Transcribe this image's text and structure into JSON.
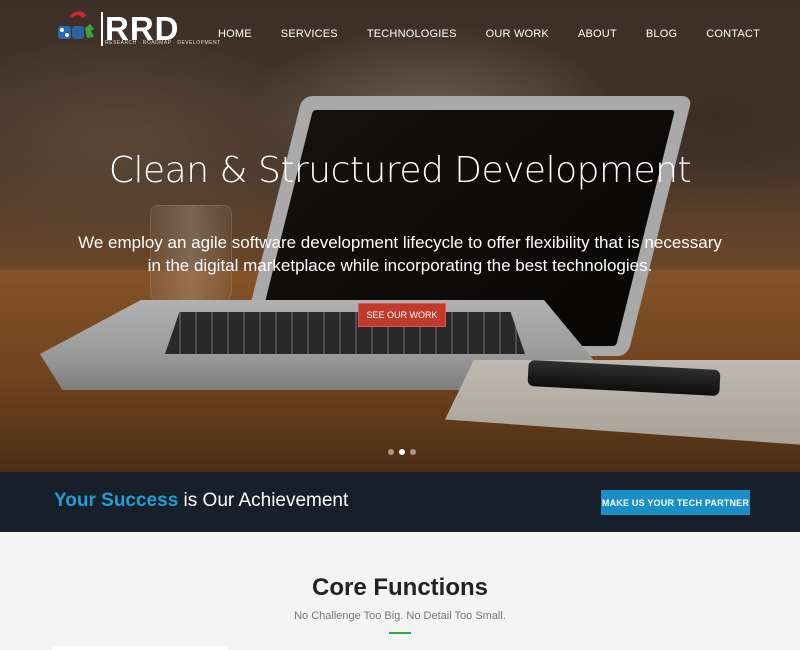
{
  "brand": {
    "name": "RRD",
    "tagline": "RESEARCH · ROADMAP · DEVELOPMENT",
    "colors": {
      "red": "#d4262e",
      "blue": "#2a6bb5",
      "green": "#3aa53f"
    }
  },
  "nav": {
    "items": [
      "HOME",
      "SERVICES",
      "TECHNOLOGIES",
      "OUR WORK",
      "ABOUT",
      "BLOG",
      "CONTACT"
    ]
  },
  "hero": {
    "title": "Clean & Structured Development",
    "subtitle": "We employ an agile software development lifecycle to offer flexibility that is necessary in the digital marketplace while incorporating the best technologies.",
    "cta": "SEE OUR WORK",
    "cta_color": "#c0392b",
    "slides": 3,
    "active_slide": 2
  },
  "banner": {
    "highlight": "Your Success",
    "text": " is Our Achievement",
    "cta": "MAKE US YOUR TECH PARTNER",
    "highlight_color": "#1e9fd6"
  },
  "core": {
    "title": "Core Functions",
    "subtitle": "No Challenge Too Big. No Detail Too Small.",
    "accent": "#2aa84a"
  }
}
